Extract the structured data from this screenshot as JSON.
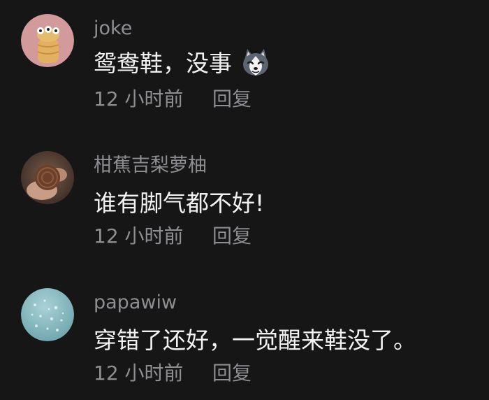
{
  "comments": [
    {
      "username": "joke",
      "text": "鸳鸯鞋，没事",
      "emoji": "husky-emoji",
      "time": "12 小时前",
      "reply_label": "回复"
    },
    {
      "username": "柑蕉吉梨萝柚",
      "text": "谁有脚气都不好!",
      "time": "12 小时前",
      "reply_label": "回复"
    },
    {
      "username": "papawiw",
      "text": "穿错了还好，一觉醒来鞋没了。",
      "time": "12 小时前",
      "reply_label": "回复"
    }
  ],
  "colors": {
    "background": "#161616",
    "username": "#8e8e93",
    "text": "#f2f2f2",
    "meta": "#8e8e93"
  }
}
